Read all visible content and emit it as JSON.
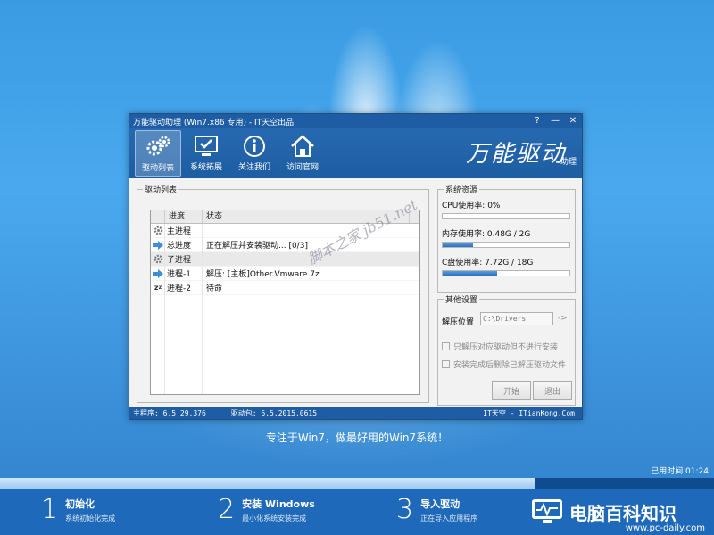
{
  "window": {
    "title": "万能驱动助理 (Win7.x86 专用) - IT天空出品",
    "buttons": {
      "help": "?",
      "minimize": "—",
      "close": "✕"
    }
  },
  "toolbar": {
    "items": [
      {
        "label": "驱动列表",
        "icon": "gears-icon"
      },
      {
        "label": "系统拓展",
        "icon": "monitor-check-icon"
      },
      {
        "label": "关注我们",
        "icon": "info-icon"
      },
      {
        "label": "访问官网",
        "icon": "home-icon"
      }
    ],
    "brand_title": "万能驱动",
    "brand_sub": "助理"
  },
  "driver_list": {
    "group_title": "驱动列表",
    "columns": [
      "进度",
      "状态"
    ],
    "rows": [
      {
        "icon": "gear-icon",
        "progress": "主进程",
        "status": ""
      },
      {
        "icon": "arrow-right-icon",
        "progress": "总进度",
        "status": "正在解压并安装驱动... [0/3]"
      },
      {
        "icon": "gear-icon",
        "progress": "子进程",
        "status": ""
      },
      {
        "icon": "arrow-right-icon",
        "progress": "进程-1",
        "status": "解压: [主板]Other.Vmware.7z"
      },
      {
        "icon": "sleep-icon",
        "progress": "进程-2",
        "status": "待命"
      }
    ]
  },
  "resources": {
    "group_title": "系统资源",
    "cpu_label": "CPU使用率:  0%",
    "cpu_level": 0,
    "mem_label": "内存使用率: 0.48G / 2G",
    "mem_level": 0.24,
    "disk_label": "C盘使用率:  7.72G / 18G",
    "disk_level": 0.43
  },
  "other_settings": {
    "group_title": "其他设置",
    "path_label": "解压位置",
    "path_value": "C:\\Drivers",
    "path_arrow": "->",
    "option1": "只解压对应驱动但不进行安装",
    "option2": "安装完成后删除已解压驱动文件",
    "start_button": "开始",
    "exit_button": "退出"
  },
  "statusbar": {
    "main_version": "主程序: 6.5.29.376",
    "driver_pack": "驱动包: 6.5.2015.0615",
    "site": "IT天空 - ITianKong.Com"
  },
  "watermark": "脚本之家 jb51.net",
  "slogan": "专注于Win7，做最好用的Win7系统！",
  "elapsed": "已用时间 01:24",
  "overall_progress": 0.75,
  "steps": [
    {
      "num": "1",
      "title": "初始化",
      "desc": "系统初始化完成"
    },
    {
      "num": "2",
      "title": "安装 Windows",
      "desc": "最小化系统安装完成"
    },
    {
      "num": "3",
      "title": "导入驱动",
      "desc": "正在导入应用程序"
    }
  ],
  "logo": {
    "text": "电脑百科知识",
    "sub": "www.pc-daily.com"
  }
}
